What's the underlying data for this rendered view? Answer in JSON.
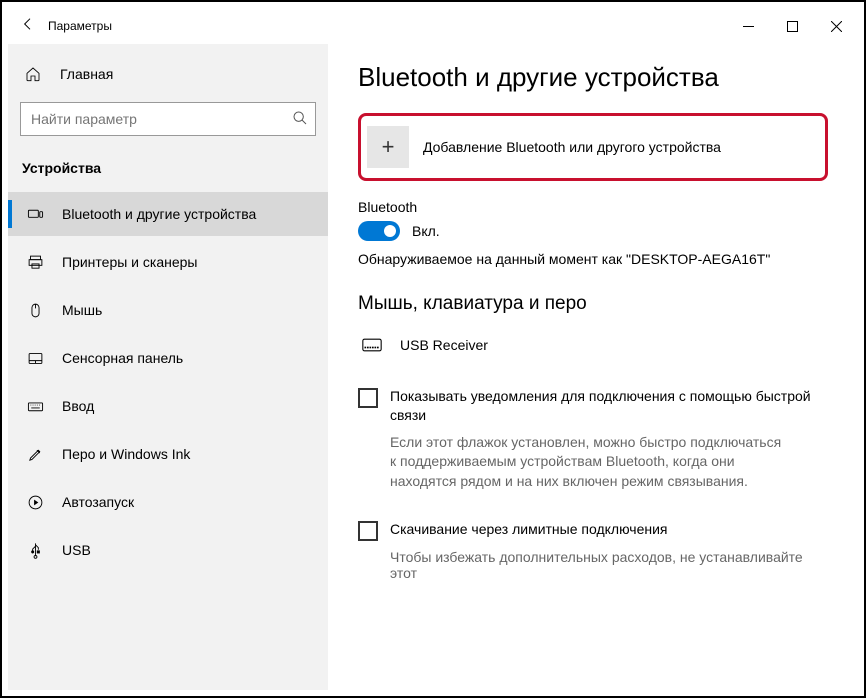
{
  "titlebar": {
    "title": "Параметры"
  },
  "sidebar": {
    "home": "Главная",
    "search_placeholder": "Найти параметр",
    "category": "Устройства",
    "items": [
      {
        "label": "Bluetooth и другие устройства"
      },
      {
        "label": "Принтеры и сканеры"
      },
      {
        "label": "Мышь"
      },
      {
        "label": "Сенсорная панель"
      },
      {
        "label": "Ввод"
      },
      {
        "label": "Перо и Windows Ink"
      },
      {
        "label": "Автозапуск"
      },
      {
        "label": "USB"
      }
    ]
  },
  "main": {
    "heading": "Bluetooth и другие устройства",
    "add_device": "Добавление Bluetooth или другого устройства",
    "bt_label": "Bluetooth",
    "toggle_state": "Вкл.",
    "discoverable": "Обнаруживаемое на данный момент как \"DESKTOP-AEGA16T\"",
    "section2": "Мышь, клавиатура и перо",
    "device1": "USB Receiver",
    "check1_label": "Показывать уведомления для подключения с помощью быстрой связи",
    "check1_desc": "Если этот флажок установлен, можно быстро подключаться к поддерживаемым устройствам Bluetooth, когда они находятся рядом и на них включен режим связывания.",
    "check2_label": "Скачивание через лимитные подключения",
    "check2_desc": "Чтобы избежать дополнительных расходов, не устанавливайте этот"
  }
}
